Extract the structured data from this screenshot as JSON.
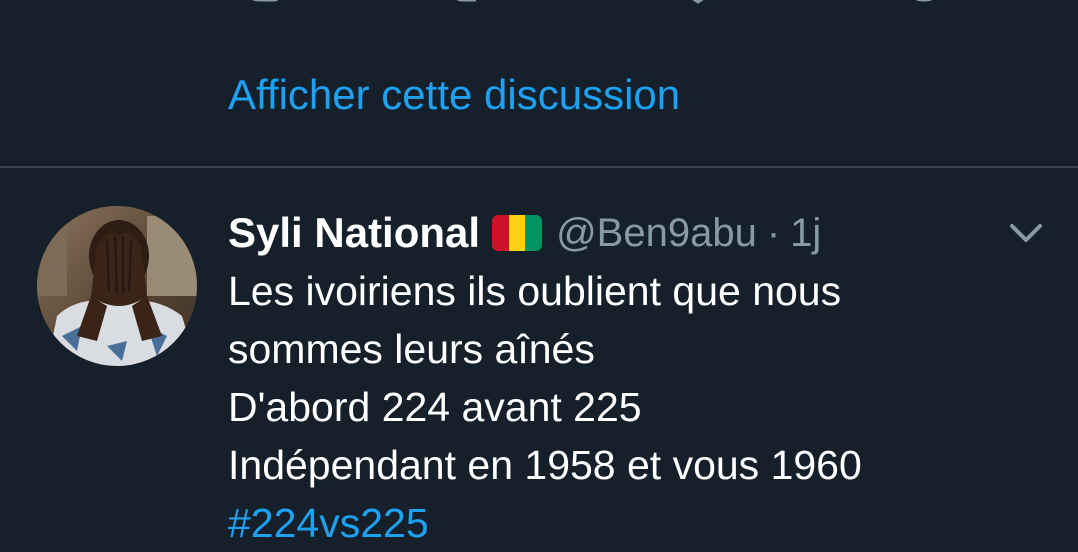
{
  "colors": {
    "background": "#15202b",
    "accent": "#1da1f2",
    "secondary_text": "#8899a6",
    "divider": "#38444d"
  },
  "previous_tweet": {
    "actions": [
      {
        "icon": "reply-icon"
      },
      {
        "icon": "retweet-icon"
      },
      {
        "icon": "like-icon"
      },
      {
        "icon": "share-icon"
      }
    ],
    "show_thread_label": "Afficher cette discussion"
  },
  "tweet": {
    "display_name": "Syli National",
    "flag_icon": "guinea-flag-icon",
    "flag_colors": [
      "#ce1126",
      "#fcd116",
      "#009460"
    ],
    "handle": "@Ben9abu",
    "separator": "·",
    "timestamp": "1j",
    "menu_icon": "chevron-down-icon",
    "text_lines": [
      "Les ivoiriens ils oublient que nous",
      "sommes leurs aînés",
      "D'abord 224 avant 225",
      "Indépendant en 1958 et vous 1960"
    ],
    "hashtag": "#224vs225"
  }
}
